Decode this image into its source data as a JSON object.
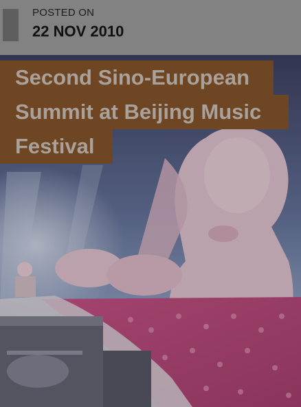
{
  "post": {
    "posted_on_label": "POSTED ON",
    "date": "22 NOV 2010",
    "title_lines": [
      "Second Sino-European",
      "Summit at Beijing Music",
      "Festival"
    ]
  },
  "colors": {
    "overlay": "#828282",
    "title_band": "#6e4624",
    "title_text": "#a9a19a",
    "date_text": "#111111"
  }
}
